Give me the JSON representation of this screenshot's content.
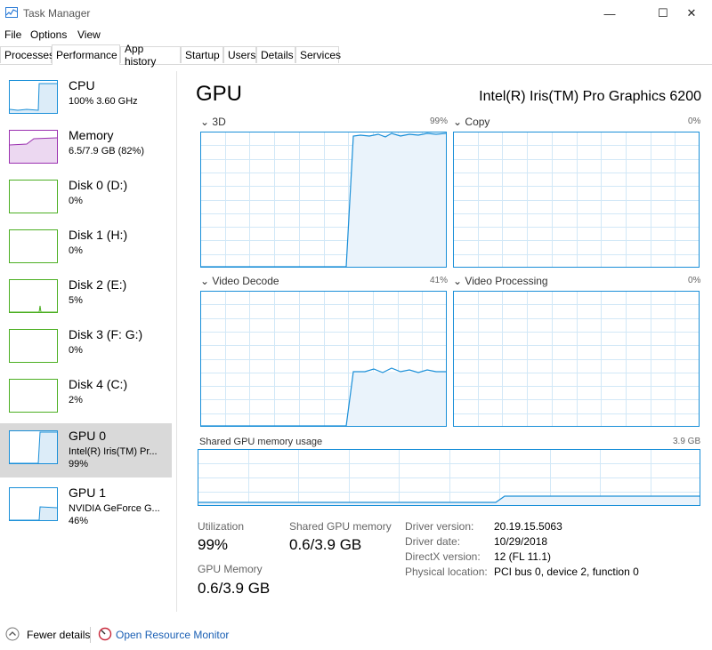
{
  "window": {
    "title": "Task Manager",
    "minimize": "—",
    "maximize": "☐",
    "close": "✕"
  },
  "menu": [
    "File",
    "Options",
    "View"
  ],
  "tabs": [
    "Processes",
    "Performance",
    "App history",
    "Startup",
    "Users",
    "Details",
    "Services"
  ],
  "colors": {
    "cpu": "#1a8fd8",
    "memory": "#9b30b0",
    "disk": "#4caf22",
    "gpu": "#1a8fd8",
    "grid": "#d2e8f7",
    "fill": "#eaf3fb"
  },
  "sidebar": [
    {
      "name": "CPU",
      "sub1": "100% 3.60 GHz",
      "type": "cpu"
    },
    {
      "name": "Memory",
      "sub1": "6.5/7.9 GB (82%)",
      "type": "memory"
    },
    {
      "name": "Disk 0 (D:)",
      "sub1": "0%",
      "type": "disk"
    },
    {
      "name": "Disk 1 (H:)",
      "sub1": "0%",
      "type": "disk"
    },
    {
      "name": "Disk 2 (E:)",
      "sub1": "5%",
      "type": "disk"
    },
    {
      "name": "Disk 3 (F: G:)",
      "sub1": "0%",
      "type": "disk"
    },
    {
      "name": "Disk 4 (C:)",
      "sub1": "2%",
      "type": "disk"
    },
    {
      "name": "GPU 0",
      "sub1": "Intel(R) Iris(TM) Pr...",
      "sub2": "99%",
      "type": "gpu",
      "selected": true
    },
    {
      "name": "GPU 1",
      "sub1": "NVIDIA GeForce G...",
      "sub2": "46%",
      "type": "gpu"
    }
  ],
  "main": {
    "title": "GPU",
    "gpu_name": "Intel(R) Iris(TM) Pro Graphics 6200",
    "graphs": [
      {
        "label": "3D",
        "pct": "99%"
      },
      {
        "label": "Copy",
        "pct": "0%"
      },
      {
        "label": "Video Decode",
        "pct": "41%"
      },
      {
        "label": "Video Processing",
        "pct": "0%"
      }
    ],
    "shared_graph": {
      "label": "Shared GPU memory usage",
      "pct": "3.9 GB"
    },
    "stats": {
      "utilization_label": "Utilization",
      "utilization": "99%",
      "shared_label": "Shared GPU memory",
      "shared": "0.6/3.9 GB",
      "gpu_mem_label": "GPU Memory",
      "gpu_mem": "0.6/3.9 GB"
    },
    "info": [
      {
        "label": "Driver version:",
        "value": "20.19.15.5063"
      },
      {
        "label": "Driver date:",
        "value": "10/29/2018"
      },
      {
        "label": "DirectX version:",
        "value": "12 (FL 11.1)"
      },
      {
        "label": "Physical location:",
        "value": "PCI bus 0, device 2, function 0"
      }
    ]
  },
  "footer": {
    "fewer": "Fewer details",
    "monitor": "Open Resource Monitor"
  }
}
